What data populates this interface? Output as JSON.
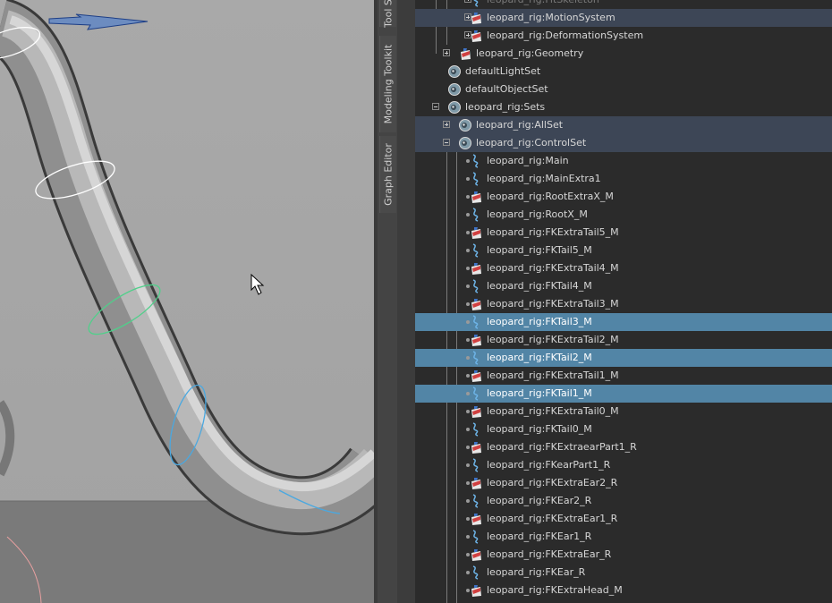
{
  "side_tabs": [
    "Tool S",
    "Modeling Toolkit",
    "Graph Editor"
  ],
  "rows": [
    {
      "label": "leopard_rig:FitSkeleton",
      "indent": 2,
      "expander": "plus",
      "icon": "curve-icon",
      "state": "faded"
    },
    {
      "label": "leopard_rig:MotionSystem",
      "indent": 2,
      "expander": "plus",
      "icon": "transform-icon",
      "state": "highlight"
    },
    {
      "label": "leopard_rig:DeformationSystem",
      "indent": 2,
      "expander": "plus",
      "icon": "transform-icon",
      "state": ""
    },
    {
      "label": "leopard_rig:Geometry",
      "indent": 1,
      "expander": "plus",
      "icon": "transform-icon",
      "state": ""
    },
    {
      "label": "defaultLightSet",
      "indent": 0,
      "expander": "",
      "icon": "set-icon",
      "state": ""
    },
    {
      "label": "defaultObjectSet",
      "indent": 0,
      "expander": "",
      "icon": "set-icon",
      "state": ""
    },
    {
      "label": "leopard_rig:Sets",
      "indent": 0,
      "expander": "minus",
      "icon": "set-icon",
      "state": ""
    },
    {
      "label": "leopard_rig:AllSet",
      "indent": 1,
      "expander": "plus",
      "icon": "set-icon",
      "state": "highlight"
    },
    {
      "label": "leopard_rig:ControlSet",
      "indent": 1,
      "expander": "minus",
      "icon": "set-icon",
      "state": "highlight"
    },
    {
      "label": "leopard_rig:Main",
      "indent": 2,
      "expander": "",
      "icon": "curve-icon",
      "state": ""
    },
    {
      "label": "leopard_rig:MainExtra1",
      "indent": 2,
      "expander": "",
      "icon": "curve-icon",
      "state": ""
    },
    {
      "label": "leopard_rig:RootExtraX_M",
      "indent": 2,
      "expander": "",
      "icon": "transform-icon",
      "state": ""
    },
    {
      "label": "leopard_rig:RootX_M",
      "indent": 2,
      "expander": "",
      "icon": "curve-icon",
      "state": ""
    },
    {
      "label": "leopard_rig:FKExtraTail5_M",
      "indent": 2,
      "expander": "",
      "icon": "transform-icon",
      "state": ""
    },
    {
      "label": "leopard_rig:FKTail5_M",
      "indent": 2,
      "expander": "",
      "icon": "curve-icon",
      "state": ""
    },
    {
      "label": "leopard_rig:FKExtraTail4_M",
      "indent": 2,
      "expander": "",
      "icon": "transform-icon",
      "state": ""
    },
    {
      "label": "leopard_rig:FKTail4_M",
      "indent": 2,
      "expander": "",
      "icon": "curve-icon",
      "state": ""
    },
    {
      "label": "leopard_rig:FKExtraTail3_M",
      "indent": 2,
      "expander": "",
      "icon": "transform-icon",
      "state": ""
    },
    {
      "label": "leopard_rig:FKTail3_M",
      "indent": 2,
      "expander": "",
      "icon": "curve-icon",
      "state": "selected"
    },
    {
      "label": "leopard_rig:FKExtraTail2_M",
      "indent": 2,
      "expander": "",
      "icon": "transform-icon",
      "state": ""
    },
    {
      "label": "leopard_rig:FKTail2_M",
      "indent": 2,
      "expander": "",
      "icon": "curve-icon",
      "state": "selected"
    },
    {
      "label": "leopard_rig:FKExtraTail1_M",
      "indent": 2,
      "expander": "",
      "icon": "transform-icon",
      "state": ""
    },
    {
      "label": "leopard_rig:FKTail1_M",
      "indent": 2,
      "expander": "",
      "icon": "curve-icon",
      "state": "selected"
    },
    {
      "label": "leopard_rig:FKExtraTail0_M",
      "indent": 2,
      "expander": "",
      "icon": "transform-icon",
      "state": ""
    },
    {
      "label": "leopard_rig:FKTail0_M",
      "indent": 2,
      "expander": "",
      "icon": "curve-icon",
      "state": ""
    },
    {
      "label": "leopard_rig:FKExtraearPart1_R",
      "indent": 2,
      "expander": "",
      "icon": "transform-icon",
      "state": ""
    },
    {
      "label": "leopard_rig:FKearPart1_R",
      "indent": 2,
      "expander": "",
      "icon": "curve-icon",
      "state": ""
    },
    {
      "label": "leopard_rig:FKExtraEar2_R",
      "indent": 2,
      "expander": "",
      "icon": "transform-icon",
      "state": ""
    },
    {
      "label": "leopard_rig:FKEar2_R",
      "indent": 2,
      "expander": "",
      "icon": "curve-icon",
      "state": ""
    },
    {
      "label": "leopard_rig:FKExtraEar1_R",
      "indent": 2,
      "expander": "",
      "icon": "transform-icon",
      "state": ""
    },
    {
      "label": "leopard_rig:FKEar1_R",
      "indent": 2,
      "expander": "",
      "icon": "curve-icon",
      "state": ""
    },
    {
      "label": "leopard_rig:FKExtraEar_R",
      "indent": 2,
      "expander": "",
      "icon": "transform-icon",
      "state": ""
    },
    {
      "label": "leopard_rig:FKEar_R",
      "indent": 2,
      "expander": "",
      "icon": "curve-icon",
      "state": ""
    },
    {
      "label": "leopard_rig:FKExtraHead_M",
      "indent": 2,
      "expander": "",
      "icon": "transform-icon",
      "state": ""
    }
  ],
  "colors": {
    "viewport_bg": "#a6a6a6",
    "selection": "#5285a6",
    "highlight": "#3d4656",
    "outliner_bg": "#2b2b2b"
  }
}
